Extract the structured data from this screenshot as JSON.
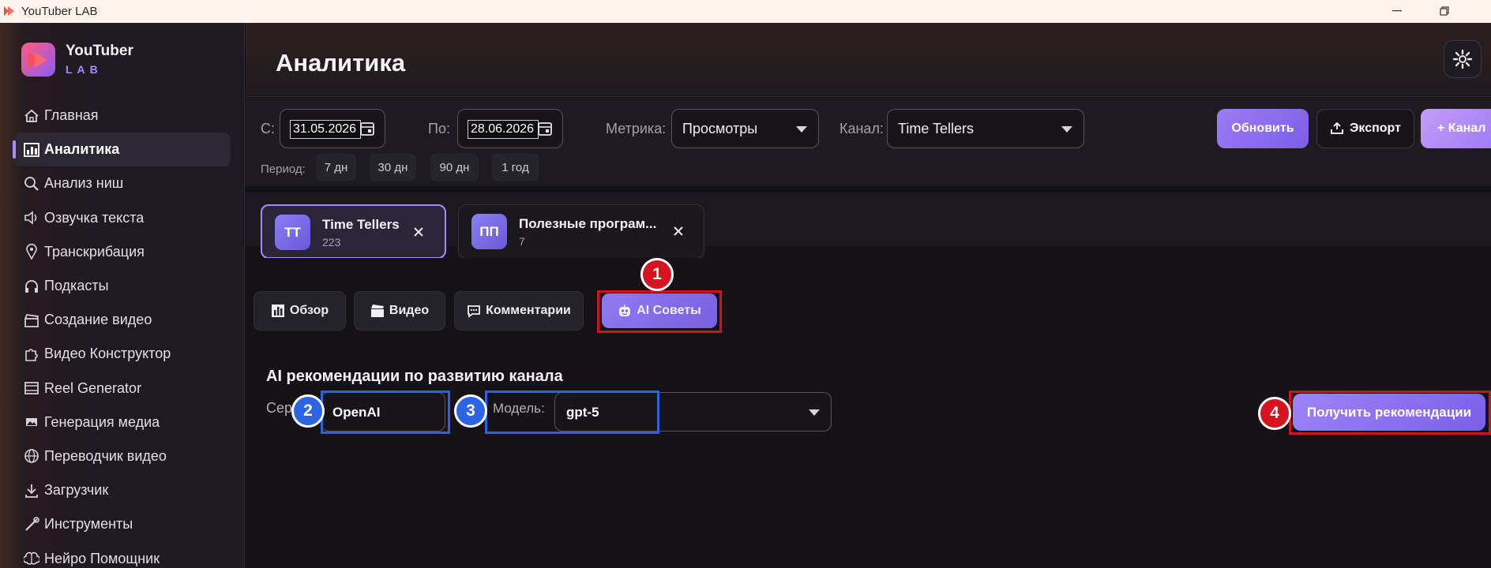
{
  "window": {
    "title": "YouTuber LAB"
  },
  "brand": {
    "name": "YouTuber",
    "sub": "LAB"
  },
  "nav": [
    {
      "label": "Главная",
      "icon": "home-icon"
    },
    {
      "label": "Аналитика",
      "icon": "bar-chart-icon",
      "active": true
    },
    {
      "label": "Анализ ниш",
      "icon": "magnifier-icon"
    },
    {
      "label": "Озвучка текста",
      "icon": "speaker-icon"
    },
    {
      "label": "Транскрибация",
      "icon": "pin-icon"
    },
    {
      "label": "Подкасты",
      "icon": "headphones-icon"
    },
    {
      "label": "Создание видео",
      "icon": "clapperboard-icon"
    },
    {
      "label": "Видео Конструктор",
      "icon": "puzzle-icon"
    },
    {
      "label": "Reel Generator",
      "icon": "film-icon"
    },
    {
      "label": "Генерация медиа",
      "icon": "image-icon"
    },
    {
      "label": "Переводчик видео",
      "icon": "globe-icon"
    },
    {
      "label": "Загрузчик",
      "icon": "download-icon"
    },
    {
      "label": "Инструменты",
      "icon": "wrench-icon"
    },
    {
      "label": "Нейро Помощник",
      "icon": "brain-icon"
    }
  ],
  "header": {
    "title": "Аналитика"
  },
  "filters": {
    "from_label": "С:",
    "from_value": "31.05.2026",
    "to_label": "По:",
    "to_value": "28.06.2026",
    "metric_label": "Метрика:",
    "metric_value": "Просмотры",
    "channel_label": "Канал:",
    "channel_value": "Time Tellers",
    "refresh_label": "Обновить",
    "export_label": "Экспорт",
    "add_channel_label": "+ Канал",
    "period_label": "Период:",
    "periods": [
      "7 дн",
      "30 дн",
      "90 дн",
      "1 год"
    ]
  },
  "channels": [
    {
      "initials": "TT",
      "name": "Time Tellers",
      "count": "223",
      "active": true
    },
    {
      "initials": "ПП",
      "name": "Полезные програм...",
      "count": "7",
      "active": false
    }
  ],
  "tabs": [
    {
      "label": "Обзор",
      "icon": "chart-icon"
    },
    {
      "label": "Видео",
      "icon": "clapper-icon"
    },
    {
      "label": "Комментарии",
      "icon": "comment-icon"
    },
    {
      "label": "AI Советы",
      "icon": "robot-icon",
      "active": true
    }
  ],
  "ai": {
    "section_title": "AI рекомендации по развитию канала",
    "service_label": "Сер",
    "service_value": "OpenAI",
    "model_label": "Модель:",
    "model_value": "gpt-5",
    "get_button": "Получить рекомендации"
  },
  "annotations": [
    "1",
    "2",
    "3",
    "4"
  ],
  "colors": {
    "accent": "#9b7cf7",
    "highlight_red": "#d4121d",
    "highlight_blue": "#2c62e2",
    "background": "#151318"
  }
}
